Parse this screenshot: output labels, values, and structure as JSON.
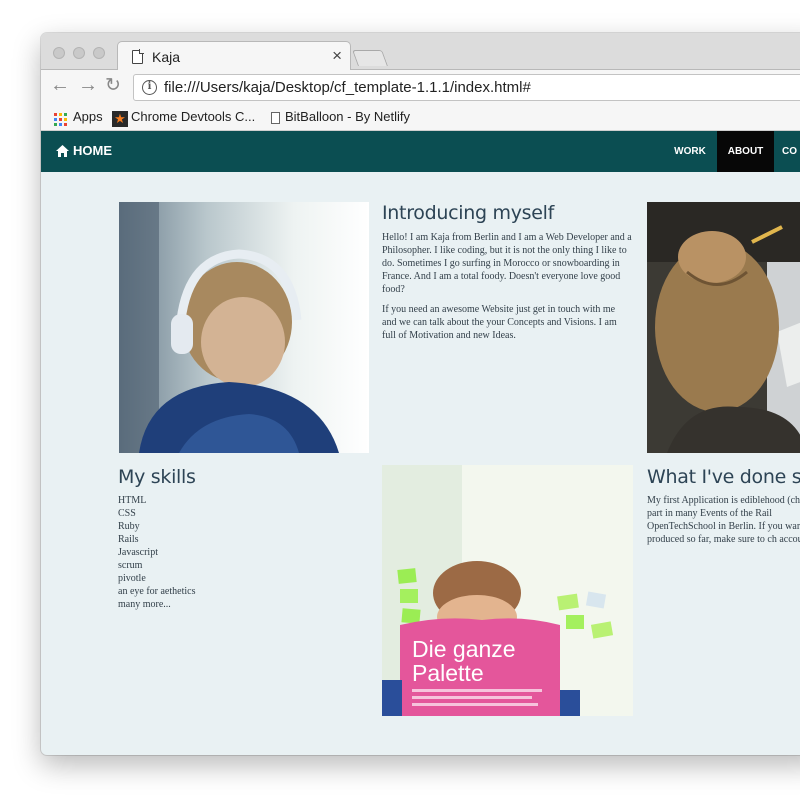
{
  "browser": {
    "tab_title": "Kaja",
    "url": "file:///Users/kaja/Desktop/cf_template-1.1.1/index.html#",
    "bookmarks": [
      {
        "label": "Apps",
        "icon": "apps-grid-icon"
      },
      {
        "label": "Chrome Devtools C...",
        "icon": "star-icon"
      },
      {
        "label": "BitBalloon - By Netlify",
        "icon": "page-icon"
      }
    ]
  },
  "site": {
    "nav": {
      "home_label": "HOME",
      "links": [
        {
          "label": "WORK",
          "active": false
        },
        {
          "label": "ABOUT",
          "active": true
        },
        {
          "label": "CO",
          "active": false
        }
      ]
    },
    "intro": {
      "heading": "Introducing myself",
      "p1": "Hello! I am Kaja from Berlin and I am a Web Developer and a Philosopher. I like coding, but it is not the only thing I like to do. Sometimes I go surfing in Morocco or snowboarding in France. And I am a total foody. Doesn't everyone love good food?",
      "p2": "If you need an awesome Website just get in touch with me and we can talk about the your Concepts and Visions. I am full of Motivation and new Ideas."
    },
    "skills": {
      "heading": "My skills",
      "items": [
        "HTML",
        "CSS",
        "Ruby",
        "Rails",
        "Javascript",
        "scrum",
        "pivotle",
        "an eye for aethetics",
        "many more..."
      ]
    },
    "done": {
      "heading": "What I've done so",
      "p1": "My first Application is ediblehood (ch taken part in many Events of the Rail OpenTechSchool in Berlin. If you war have produced so far, make sure to ch account."
    },
    "book": {
      "title": "Die ganze Palette"
    }
  },
  "colors": {
    "navbar": "#0b4e52",
    "active_nav": "#070707",
    "page_background": "#e9f1f3",
    "heading": "#2d4455"
  }
}
